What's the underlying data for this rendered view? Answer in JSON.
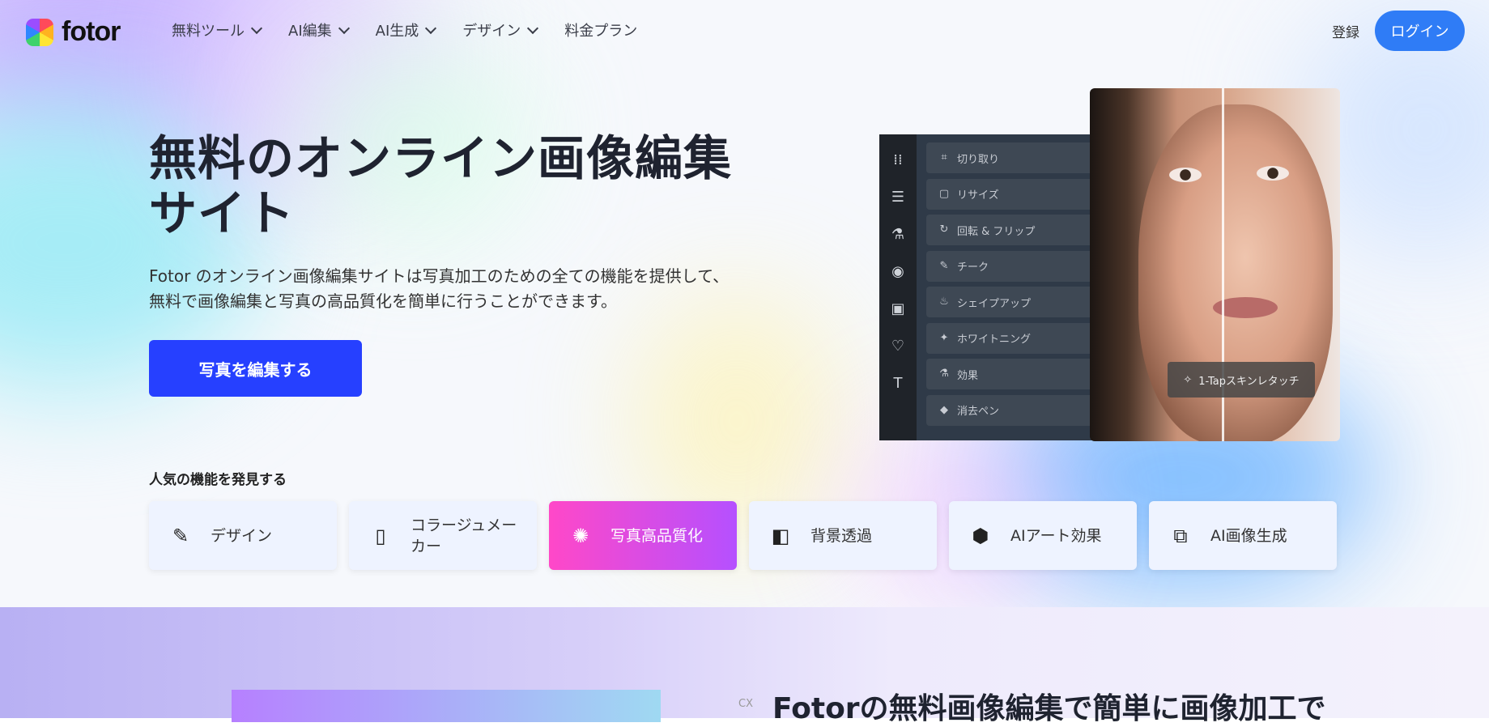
{
  "nav": {
    "logo": "fotor",
    "menu": [
      {
        "label": "無料ツール",
        "dropdown": true
      },
      {
        "label": "AI編集",
        "dropdown": true
      },
      {
        "label": "AI生成",
        "dropdown": true
      },
      {
        "label": "デザイン",
        "dropdown": true
      },
      {
        "label": "料金プラン",
        "dropdown": false
      }
    ],
    "register": "登録",
    "login": "ログイン"
  },
  "hero": {
    "title_line1": "無料のオンライン画像編集",
    "title_line2": "サイト",
    "subtitle_line1": "Fotor のオンライン画像編集サイトは写真加工のための全ての機能を提供して、",
    "subtitle_line2": "無料で画像編集と写真の高品質化を簡単に行うことができます。",
    "cta": "写真を編集する"
  },
  "editor": {
    "tools": [
      "切り取り",
      "リサイズ",
      "回転 & フリップ",
      "チーク",
      "シェイプアップ",
      "ホワイトニング",
      "効果",
      "消去ペン"
    ],
    "badge": "1-Tapスキンレタッチ"
  },
  "popular": {
    "title": "人気の機能を発見する",
    "cards": [
      {
        "label": "デザイン",
        "icon": "design-tools-icon"
      },
      {
        "label": "コラージュメーカー",
        "icon": "collage-layout-icon"
      },
      {
        "label": "写真高品質化",
        "icon": "enhance-sparkle-icon",
        "active": true
      },
      {
        "label": "背景透過",
        "icon": "background-remove-icon"
      },
      {
        "label": "AIアート効果",
        "icon": "ai-art-icon"
      },
      {
        "label": "AI画像生成",
        "icon": "ai-image-icon"
      }
    ]
  },
  "lower": {
    "heading": "Fotorの無料画像編集で簡単に画像加工で",
    "cx": "CX"
  },
  "colors": {
    "accent": "#2640ff",
    "login": "#2f7cf6",
    "active_card_start": "#ff48c8",
    "active_card_end": "#b550ff"
  }
}
